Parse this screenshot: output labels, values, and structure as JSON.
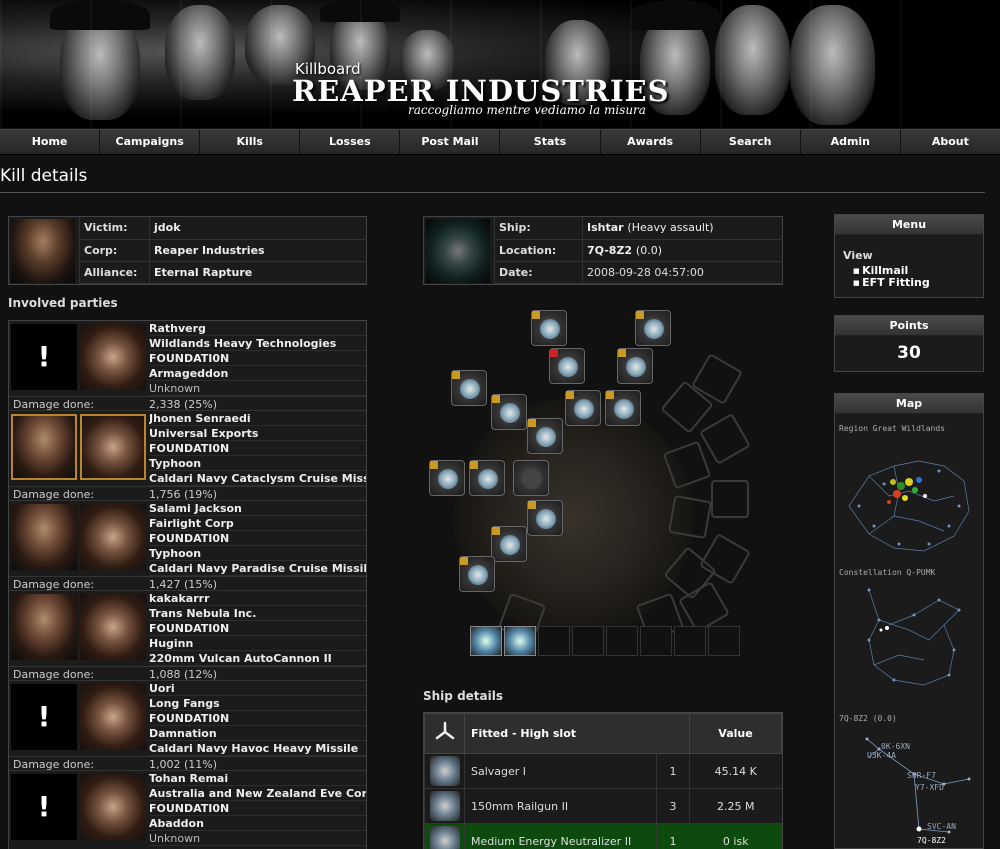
{
  "banner": {
    "subtitle": "Killboard",
    "title": "REAPER INDUSTRIES",
    "motto": "raccogliamo mentre vediamo la misura"
  },
  "nav": [
    "Home",
    "Campaigns",
    "Kills",
    "Losses",
    "Post Mail",
    "Stats",
    "Awards",
    "Search",
    "Admin",
    "About"
  ],
  "page_title": "Kill details",
  "victim": {
    "victim_label": "Victim:",
    "victim": "jdok",
    "corp_label": "Corp:",
    "corp": "Reaper Industries",
    "alliance_label": "Alliance:",
    "alliance": "Eternal Rapture"
  },
  "ship_info": {
    "ship_label": "Ship:",
    "ship": "Ishtar",
    "ship_class": "(Heavy assault)",
    "location_label": "Location:",
    "location": "7Q-8Z2",
    "security": "(0.0)",
    "date_label": "Date:",
    "date": "2008-09-28 04:57:00"
  },
  "involved_title": "Involved parties",
  "damage_label": "Damage done:",
  "parties": [
    {
      "pilot": "Rathverg",
      "corp": "Wildlands Heavy Technologies",
      "alliance": "FOUNDATI0N",
      "ship": "Armageddon",
      "weapon": "Unknown",
      "damage": "2,338 (25%)",
      "portrait": "unknown",
      "highlight": false
    },
    {
      "pilot": "Jhonen Senraedi",
      "corp": "Universal Exports",
      "alliance": "FOUNDATI0N",
      "ship": "Typhoon",
      "weapon": "Caldari Navy Cataclysm Cruise Missile",
      "damage": "1,756 (19%)",
      "portrait": "char",
      "highlight": true
    },
    {
      "pilot": "Salami Jackson",
      "corp": "Fairlight Corp",
      "alliance": "FOUNDATI0N",
      "ship": "Typhoon",
      "weapon": "Caldari Navy Paradise Cruise Missile",
      "damage": "1,427 (15%)",
      "portrait": "char",
      "highlight": false
    },
    {
      "pilot": "kakakarrr",
      "corp": "Trans Nebula Inc.",
      "alliance": "FOUNDATI0N",
      "ship": "Huginn",
      "weapon": "220mm Vulcan AutoCannon II",
      "damage": "1,088 (12%)",
      "portrait": "char",
      "highlight": false
    },
    {
      "pilot": "Uori",
      "corp": "Long Fangs",
      "alliance": "FOUNDATI0N",
      "ship": "Damnation",
      "weapon": "Caldari Navy Havoc Heavy Missile",
      "damage": "1,002 (11%)",
      "portrait": "unknown",
      "highlight": false
    },
    {
      "pilot": "Tohan Remai",
      "corp": "Australia and New Zealand Eve Corp",
      "alliance": "FOUNDATI0N",
      "ship": "Abaddon",
      "weapon": "Unknown",
      "damage": "",
      "portrait": "unknown",
      "highlight": false
    }
  ],
  "ship_details_title": "Ship details",
  "details": {
    "header_slot": "Fitted - High slot",
    "header_value": "Value",
    "rows": [
      {
        "name": "Salvager I",
        "qty": "1",
        "value": "45.14 K",
        "dropped": false
      },
      {
        "name": "150mm Railgun II",
        "qty": "3",
        "value": "2.25 M",
        "dropped": false
      },
      {
        "name": "Medium Energy Neutralizer II",
        "qty": "1",
        "value": "0 isk",
        "dropped": true
      }
    ]
  },
  "sidebar": {
    "menu_title": "Menu",
    "menu_view": "View",
    "menu_links": [
      "Killmail",
      "EFT Fitting"
    ],
    "points_title": "Points",
    "points": "30",
    "map_title": "Map",
    "map_region": "Region Great Wildlands",
    "map_constellation": "Constellation Q-PUMK",
    "map_system": "7Q-8Z2 (0.0)",
    "map_systems": [
      "0K-6XN",
      "U3K-4A",
      "SUR-F7",
      "Y7-XFD",
      "SVC-AN",
      "7Q-8Z2"
    ]
  },
  "colors": {
    "accent": "#c89a22",
    "dropped": "#0d4a0d",
    "nav_bg": "#2c2c2c",
    "background": "#111111"
  }
}
